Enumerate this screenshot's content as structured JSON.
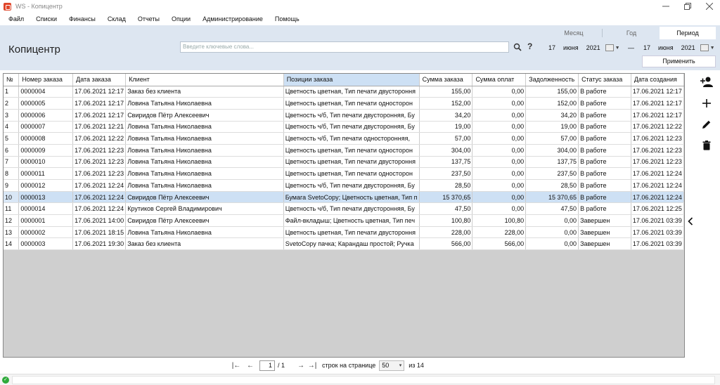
{
  "window": {
    "title": "WS - Копицентр"
  },
  "menu": [
    "Файл",
    "Списки",
    "Финансы",
    "Склад",
    "Отчеты",
    "Опции",
    "Администрирование",
    "Помощь"
  ],
  "header": {
    "title": "Копицентр",
    "search_placeholder": "Введите ключевые слова...",
    "help_label": "?",
    "period_tabs": [
      "Месяц",
      "Год",
      "Период"
    ],
    "selected_period": "Период",
    "date_from": {
      "day": "17",
      "month": "июня",
      "year": "2021"
    },
    "date_to": {
      "day": "17",
      "month": "июня",
      "year": "2021"
    },
    "dash": "—",
    "apply_label": "Применить"
  },
  "table": {
    "columns": [
      "№",
      "Номер заказа",
      "Дата заказа",
      "Клиент",
      "Позиции заказа",
      "Сумма заказа",
      "Сумма оплат",
      "Задолженность",
      "Статус заказа",
      "Дата создания"
    ],
    "highlighted_column": 4,
    "selected_row": 9,
    "rows": [
      [
        "1",
        "0000004",
        "17.06.2021 12:17",
        "Заказ без клиента",
        "Цветность цветная, Тип печати двустороння",
        "155,00",
        "0,00",
        "155,00",
        "В работе",
        "17.06.2021 12:17"
      ],
      [
        "2",
        "0000005",
        "17.06.2021 12:17",
        "Ловина Татьяна Николаевна",
        "Цветность цветная, Тип печати односторон",
        "152,00",
        "0,00",
        "152,00",
        "В работе",
        "17.06.2021 12:17"
      ],
      [
        "3",
        "0000006",
        "17.06.2021 12:17",
        "Свиридов Пётр Алексеевич",
        "Цветность ч/б, Тип печати двусторонняя, Бу",
        "34,20",
        "0,00",
        "34,20",
        "В работе",
        "17.06.2021 12:17"
      ],
      [
        "4",
        "0000007",
        "17.06.2021 12:21",
        "Ловина Татьяна Николаевна",
        "Цветность ч/б, Тип печати двусторонняя, Бу",
        "19,00",
        "0,00",
        "19,00",
        "В работе",
        "17.06.2021 12:22"
      ],
      [
        "5",
        "0000008",
        "17.06.2021 12:22",
        "Ловина Татьяна Николаевна",
        "Цветность ч/б, Тип печати односторонняя,",
        "57,00",
        "0,00",
        "57,00",
        "В работе",
        "17.06.2021 12:23"
      ],
      [
        "6",
        "0000009",
        "17.06.2021 12:23",
        "Ловина Татьяна Николаевна",
        "Цветность цветная, Тип печати односторон",
        "304,00",
        "0,00",
        "304,00",
        "В работе",
        "17.06.2021 12:23"
      ],
      [
        "7",
        "0000010",
        "17.06.2021 12:23",
        "Ловина Татьяна Николаевна",
        "Цветность цветная, Тип печати двустороння",
        "137,75",
        "0,00",
        "137,75",
        "В работе",
        "17.06.2021 12:23"
      ],
      [
        "8",
        "0000011",
        "17.06.2021 12:23",
        "Ловина Татьяна Николаевна",
        "Цветность цветная, Тип печати односторон",
        "237,50",
        "0,00",
        "237,50",
        "В работе",
        "17.06.2021 12:24"
      ],
      [
        "9",
        "0000012",
        "17.06.2021 12:24",
        "Ловина Татьяна Николаевна",
        "Цветность ч/б, Тип печати двусторонняя, Бу",
        "28,50",
        "0,00",
        "28,50",
        "В работе",
        "17.06.2021 12:24"
      ],
      [
        "10",
        "0000013",
        "17.06.2021 12:24",
        "Свиридов Пётр Алексеевич",
        "Бумага SvetoCopy; Цветность цветная, Тип п",
        "15 370,65",
        "0,00",
        "15 370,65",
        "В работе",
        "17.06.2021 12:24"
      ],
      [
        "11",
        "0000014",
        "17.06.2021 12:24",
        "Крутиков Сергей Владимирович",
        "Цветность ч/б, Тип печати двусторонняя, Бу",
        "47,50",
        "0,00",
        "47,50",
        "В работе",
        "17.06.2021 12:25"
      ],
      [
        "12",
        "0000001",
        "17.06.2021 14:00",
        "Свиридов Пётр Алексеевич",
        "Файл-вкладыш; Цветность цветная, Тип печ",
        "100,80",
        "100,80",
        "0,00",
        "Завершен",
        "17.06.2021 03:39"
      ],
      [
        "13",
        "0000002",
        "17.06.2021 18:15",
        "Ловина Татьяна Николаевна",
        "Цветность цветная, Тип печати двустороння",
        "228,00",
        "228,00",
        "0,00",
        "Завершен",
        "17.06.2021 03:39"
      ],
      [
        "14",
        "0000003",
        "17.06.2021 19:30",
        "Заказ без клиента",
        "SvetoCopy пачка; Карандаш простой; Ручка",
        "566,00",
        "566,00",
        "0,00",
        "Завершен",
        "17.06.2021 03:39"
      ]
    ]
  },
  "toolbar_icons": [
    "add-person-icon",
    "plus-icon",
    "pencil-icon",
    "trash-icon",
    "chevron-left-icon"
  ],
  "pager": {
    "first": "|←",
    "prev": "←",
    "page": "1",
    "of": "/ 1",
    "next": "→",
    "last": "→|",
    "rows_label": "строк на странице",
    "page_size": "50",
    "total_label": "из 14"
  },
  "colors": {
    "header_bg": "#dde6f1",
    "selection": "#cde0f4",
    "status_ok": "#2eaa3a",
    "grid_empty": "#cfcfcf"
  }
}
